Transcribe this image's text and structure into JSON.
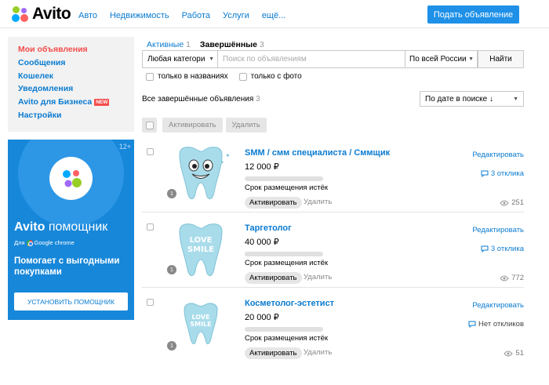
{
  "header": {
    "logo_text": "Avito",
    "nav": [
      "Авто",
      "Недвижимость",
      "Работа",
      "Услуги",
      "ещё..."
    ],
    "post_button": "Подать объявление"
  },
  "sidebar": {
    "items": [
      {
        "label": "Мои объявления",
        "active": true
      },
      {
        "label": "Сообщения"
      },
      {
        "label": "Кошелек"
      },
      {
        "label": "Уведомления"
      },
      {
        "label": "Avito для Бизнеса",
        "badge": "NEW"
      },
      {
        "label": "Настройки"
      }
    ]
  },
  "banner": {
    "age": "12+",
    "title_bold": "Avito",
    "title_normal": "помощник",
    "for_label": "Для",
    "for_browser": "Google chrome",
    "promo": "Помогает с выгодными покупками",
    "install_button": "УСТАНОВИТЬ ПОМОЩНИК"
  },
  "tabs": [
    {
      "label": "Активные",
      "count": "1"
    },
    {
      "label": "Завершённые",
      "count": "3"
    }
  ],
  "search": {
    "category": "Любая категори",
    "placeholder": "Поиск по объявлениям",
    "region": "По всей России",
    "find_button": "Найти"
  },
  "filters": {
    "titles_only": "только в названиях",
    "with_photo": "только с фото"
  },
  "list_header": {
    "title": "Все завершённые объявления",
    "count": "3",
    "sort": "По дате в поиске ↓"
  },
  "bulk": {
    "activate": "Активировать",
    "delete": "Удалить"
  },
  "listings": [
    {
      "title": "SMM / смм специалиста / Сммщик",
      "price": "12 000 ₽",
      "photo_count": "1",
      "status": "Срок размещения истёк",
      "activate": "Активировать",
      "delete": "Удалить",
      "edit": "Редактировать",
      "responses": "3 отклика",
      "views": "251"
    },
    {
      "title": "Таргетолог",
      "price": "40 000 ₽",
      "photo_count": "1",
      "status": "Срок размещения истёк",
      "activate": "Активировать",
      "delete": "Удалить",
      "edit": "Редактировать",
      "responses": "3 отклика",
      "views": "772",
      "image_text": [
        "LOVE",
        "SMILE"
      ]
    },
    {
      "title": "Косметолог-эстетист",
      "price": "20 000 ₽",
      "photo_count": "1",
      "status": "Срок размещения истёк",
      "activate": "Активировать",
      "delete": "Удалить",
      "edit": "Редактировать",
      "responses": "Нет откликов",
      "views": "51",
      "image_text": [
        "LOVE",
        "SMILE"
      ]
    }
  ],
  "colors": {
    "brand_blue": "#1e90e8",
    "link_blue": "#0a7bd0",
    "active_red": "#f54c4c",
    "banner_blue": "#1787d9",
    "tooth_fill": "#a9dcea"
  }
}
